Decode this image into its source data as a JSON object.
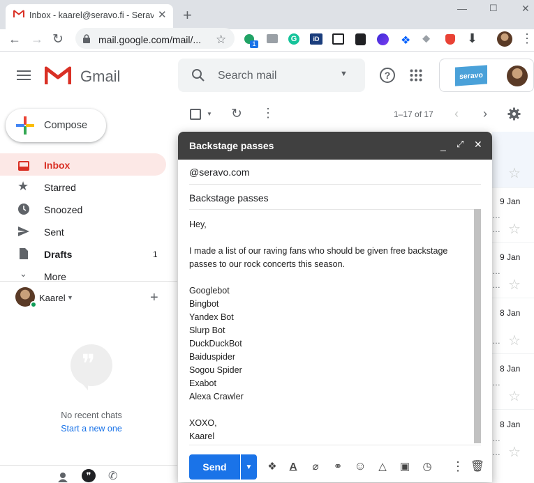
{
  "browser": {
    "tab_title": "Inbox - kaarel@seravo.fi - Seravo",
    "url": "mail.google.com/mail/...",
    "extension_badge": "1"
  },
  "gmail": {
    "product_name": "Gmail",
    "search_placeholder": "Search mail",
    "account_logo_text": "seravo"
  },
  "sidebar": {
    "compose_label": "Compose",
    "items": [
      {
        "label": "Inbox",
        "count": ""
      },
      {
        "label": "Starred",
        "count": ""
      },
      {
        "label": "Snoozed",
        "count": ""
      },
      {
        "label": "Sent",
        "count": ""
      },
      {
        "label": "Drafts",
        "count": "1"
      },
      {
        "label": "More",
        "count": ""
      }
    ],
    "hangouts_user": "Kaarel",
    "no_recent_chats": "No recent chats",
    "start_new": "Start a new one"
  },
  "list": {
    "pager": "1–17 of 17",
    "dates": [
      "9 Jan",
      "9 Jan",
      "8 Jan",
      "8 Jan",
      "8 Jan"
    ]
  },
  "compose": {
    "title": "Backstage passes",
    "to": "@seravo.com",
    "subject": "Backstage passes",
    "body_lines": [
      "Hey,",
      "",
      "I made a list of our raving fans who should be given free backstage",
      "passes to our rock concerts this season.",
      "",
      "Googlebot",
      "Bingbot",
      "Yandex Bot",
      "Slurp Bot",
      "DuckDuckBot",
      "Baiduspider",
      "Sogou Spider",
      "Exabot",
      "Alexa Crawler",
      "",
      "XOXO,",
      "Kaarel"
    ],
    "send_label": "Send"
  },
  "colors": {
    "accent": "#1a73e8",
    "inbox_active_bg": "#fce8e6",
    "inbox_red": "#d93025",
    "compose_header": "#404040"
  }
}
